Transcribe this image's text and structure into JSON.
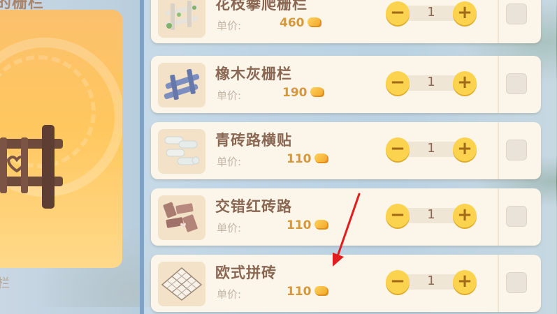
{
  "preview": {
    "title": "的栅栏",
    "label": "栏"
  },
  "price_label": "单价:",
  "items": [
    {
      "name": "花枝攀爬栅栏",
      "price": "460",
      "qty": "1",
      "icon": "flower-fence-icon"
    },
    {
      "name": "橡木灰栅栏",
      "price": "190",
      "qty": "1",
      "icon": "gray-oak-fence-icon"
    },
    {
      "name": "青砖路横贴",
      "price": "110",
      "qty": "1",
      "icon": "blue-brick-path-icon"
    },
    {
      "name": "交错红砖路",
      "price": "110",
      "qty": "1",
      "icon": "red-brick-path-icon"
    },
    {
      "name": "欧式拼砖",
      "price": "110",
      "qty": "1",
      "icon": "european-tile-icon"
    }
  ],
  "colors": {
    "accent": "#fbd34f",
    "price": "#d6983a",
    "name": "#8a6752",
    "panel_border": "#7ea3c6",
    "arrow": "#e01e1e"
  }
}
